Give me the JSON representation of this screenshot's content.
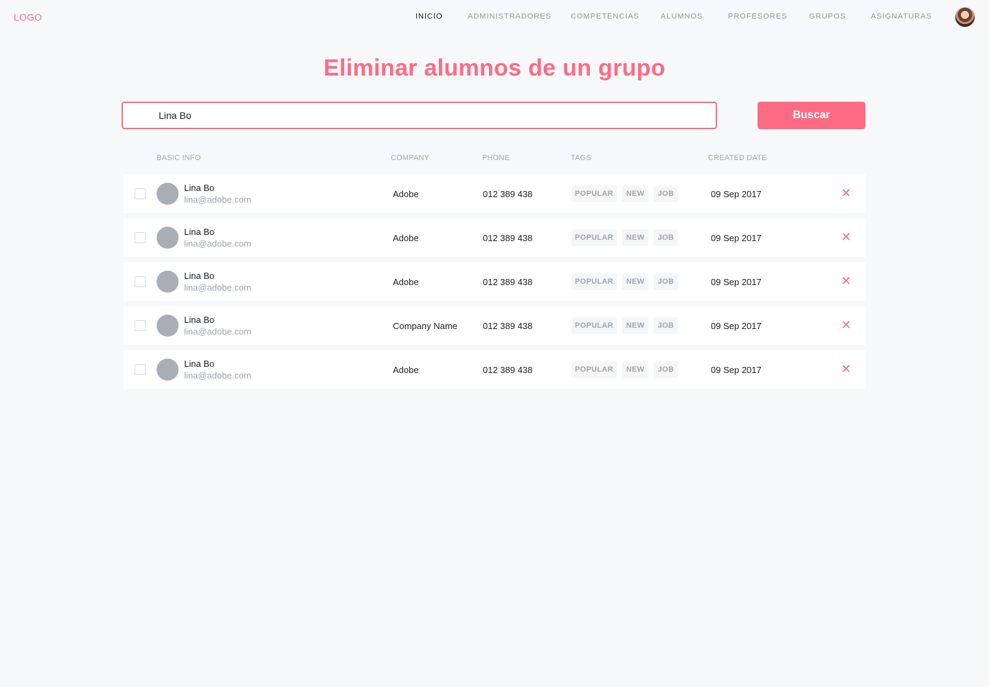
{
  "header": {
    "logo": "LOGO",
    "nav": [
      {
        "label": "INICIO",
        "active": true
      },
      {
        "label": "ADMINISTRADORES",
        "active": false
      },
      {
        "label": "COMPETENCIAS",
        "active": false
      },
      {
        "label": "ALUMNOS",
        "active": false
      },
      {
        "label": "PROFESORES",
        "active": false
      },
      {
        "label": "GRUPOS",
        "active": false
      },
      {
        "label": "ASIGNATURAS",
        "active": false
      }
    ]
  },
  "page": {
    "title": "Eliminar alumnos de un grupo"
  },
  "search": {
    "value": "Lina Bo",
    "button_label": "Buscar"
  },
  "table": {
    "columns": [
      "BASIC INFO",
      "COMPANY",
      "PHONE",
      "TAGS",
      "CREATED DATE"
    ],
    "rows": [
      {
        "name": "Lina Bo",
        "email": "lina@adobe.com",
        "company": "Adobe",
        "phone": "012 389 438",
        "tags": [
          "POPULAR",
          "NEW",
          "JOB"
        ],
        "date": "09 Sep 2017"
      },
      {
        "name": "Lina Bo",
        "email": "lina@adobe.com",
        "company": "Adobe",
        "phone": "012 389 438",
        "tags": [
          "POPULAR",
          "NEW",
          "JOB"
        ],
        "date": "09 Sep 2017"
      },
      {
        "name": "Lina Bo",
        "email": "lina@adobe.com",
        "company": "Adobe",
        "phone": "012 389 438",
        "tags": [
          "POPULAR",
          "NEW",
          "JOB"
        ],
        "date": "09 Sep 2017"
      },
      {
        "name": "Lina Bo",
        "email": "lina@adobe.com",
        "company": "Company Name",
        "phone": "012 389 438",
        "tags": [
          "POPULAR",
          "NEW",
          "JOB"
        ],
        "date": "09 Sep 2017"
      },
      {
        "name": "Lina Bo",
        "email": "lina@adobe.com",
        "company": "Adobe",
        "phone": "012 389 438",
        "tags": [
          "POPULAR",
          "NEW",
          "JOB"
        ],
        "date": "09 Sep 2017"
      }
    ],
    "delete_icon": "close-icon"
  },
  "colors": {
    "accent": "#ff6a84",
    "background": "#f7f8fa",
    "muted_text": "#a0a5ad"
  }
}
